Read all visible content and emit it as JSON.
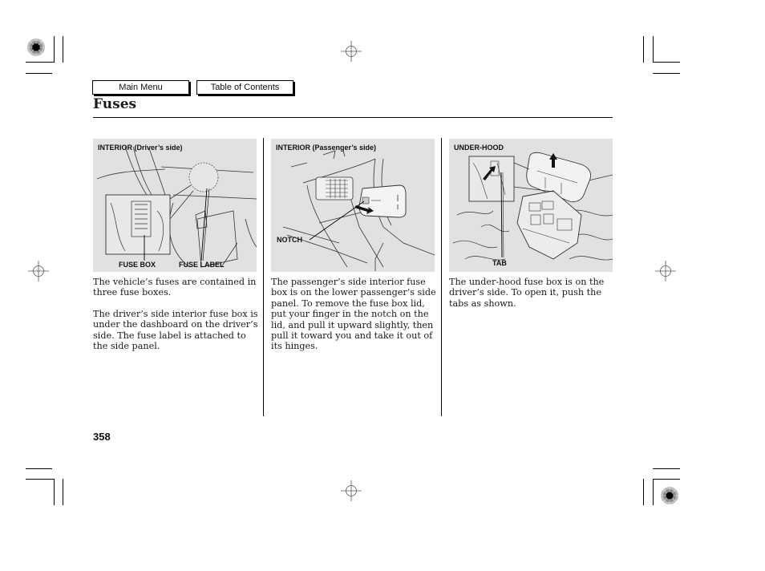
{
  "nav": {
    "main_menu": "Main Menu",
    "table_of_contents": "Table of Contents"
  },
  "page": {
    "title": "Fuses",
    "number": "358"
  },
  "figures": [
    {
      "heading": "INTERIOR (Driver’s side)",
      "callouts": [
        "FUSE BOX",
        "FUSE LABEL"
      ]
    },
    {
      "heading": "INTERIOR (Passenger’s side)",
      "callouts": [
        "NOTCH"
      ]
    },
    {
      "heading": "UNDER-HOOD",
      "callouts": [
        "TAB"
      ]
    }
  ],
  "columns": [
    {
      "paragraphs": [
        "The vehicle’s fuses are contained in three fuse boxes.",
        "The driver’s side interior fuse box is under the dashboard on the driver’s side. The fuse label is attached to the side panel."
      ]
    },
    {
      "paragraphs": [
        "The passenger’s side interior fuse box is on the lower passenger’s side panel. To remove the fuse box lid, put your finger in the notch on the lid, and pull it upward slightly, then pull it toward you and take it out of its hinges."
      ]
    },
    {
      "paragraphs": [
        "The under-hood fuse box is on the driver’s side. To open it, push the tabs as shown."
      ]
    }
  ],
  "icons": {
    "registration_mark": "registration-target",
    "color_dot": "print-color-dot"
  }
}
